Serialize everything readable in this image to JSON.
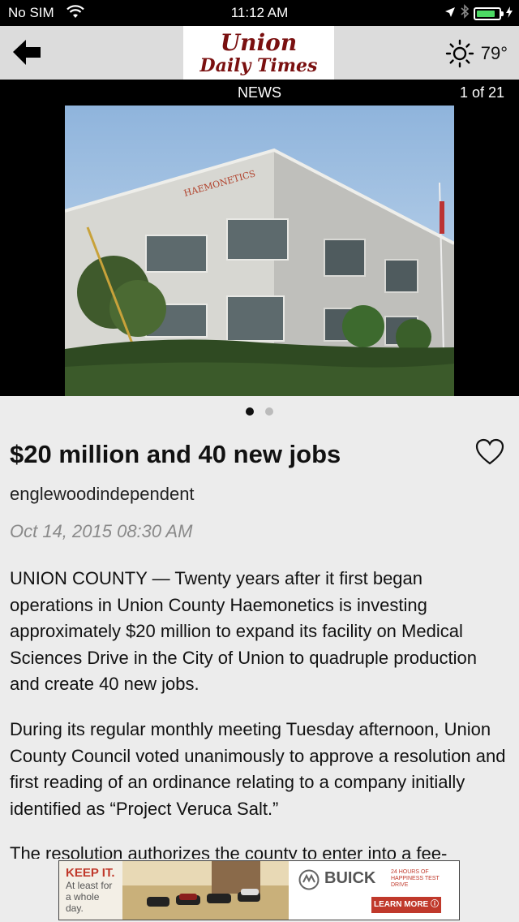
{
  "status_bar": {
    "carrier": "No SIM",
    "time": "11:12 AM",
    "battery_level": 0.85
  },
  "header": {
    "logo_line1": "Union",
    "logo_line2": "Daily Times",
    "temperature": "79°"
  },
  "news_bar": {
    "section": "NEWS",
    "counter": "1 of 21"
  },
  "gallery": {
    "image_sign": "HAEMONETICS",
    "dots": [
      true,
      false
    ]
  },
  "article": {
    "title": "$20 million and 40 new jobs",
    "author": "englewoodindependent",
    "date": "Oct 14, 2015 08:30 AM",
    "paragraphs": [
      "UNION COUNTY — Twenty years after it first began operations in Union County Haemonetics is investing approximately $20 million to expand its facility on Medical Sciences Drive in the City of Union to quadruple production and create 40 new jobs.",
      "During its regular monthly meeting Tuesday afternoon, Union County Council voted unanimously to approve a resolution and first reading of an ordinance relating to a company initially identified as “Project Veruca Salt.”",
      "The resolution authorizes the county to enter into a fee-"
    ]
  },
  "ad": {
    "keep_it": "KEEP IT.",
    "sub1": "At least for",
    "sub2": "a whole day.",
    "brand": "BUICK",
    "tagline": "24 HOURS OF HAPPINESS TEST DRIVE",
    "cta": "LEARN MORE ⓘ"
  },
  "colors": {
    "masthead": "#7a1010",
    "accent_red": "#c0392b",
    "battery": "#4cd964"
  }
}
